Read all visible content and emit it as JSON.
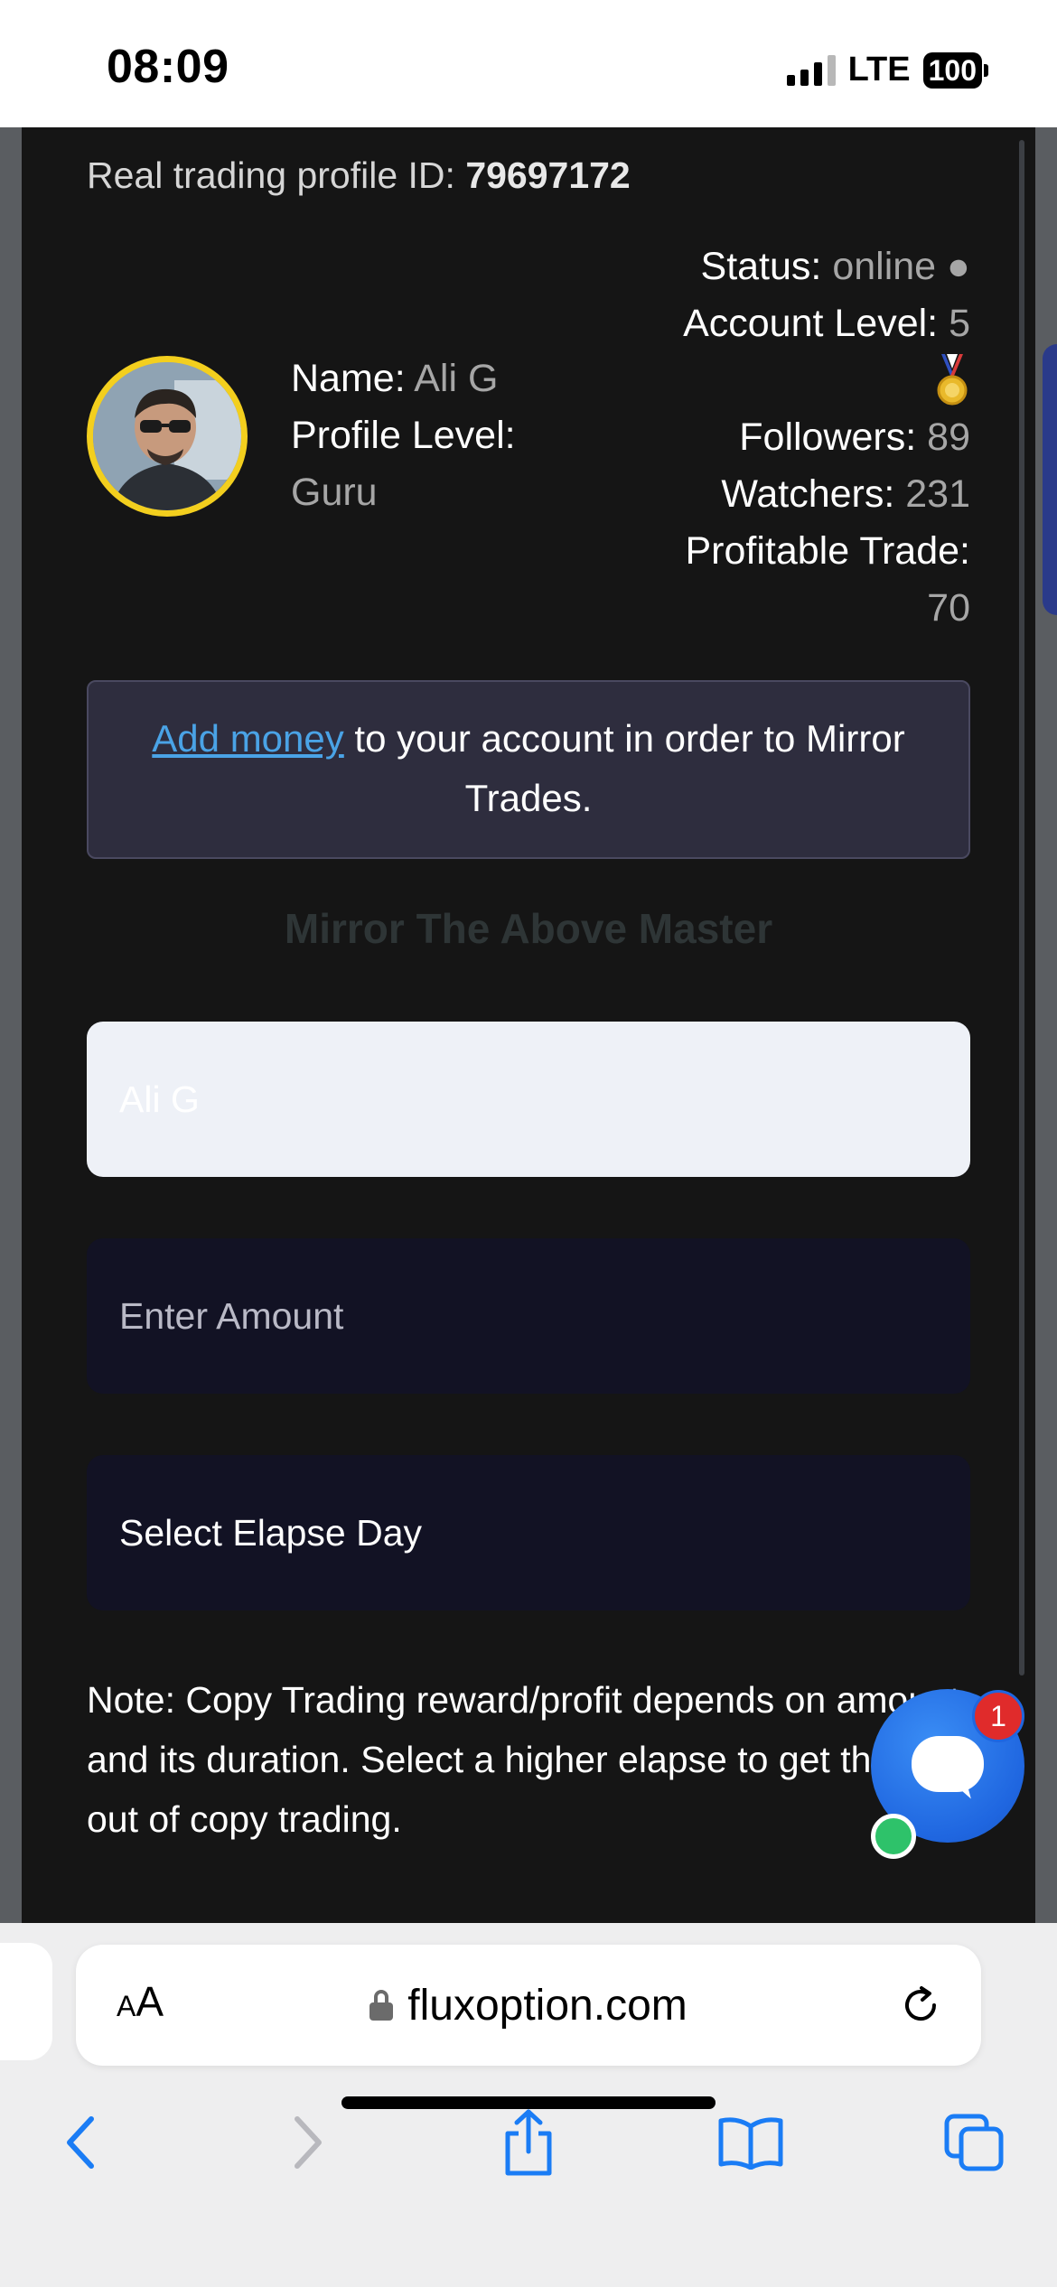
{
  "status_bar": {
    "time": "08:09",
    "network": "LTE",
    "battery": "100"
  },
  "profile": {
    "id_label": "Real trading profile ID: ",
    "id_value": "79697172",
    "name_label": "Name: ",
    "name_value": "Ali G",
    "level_label": "Profile Level:",
    "level_value": "Guru",
    "status_label": "Status: ",
    "status_value": "online ●",
    "account_level_label": "Account Level: ",
    "account_level_value": "5",
    "followers_label": "Followers: ",
    "followers_value": "89",
    "watchers_label": "Watchers: ",
    "watchers_value": "231",
    "profitable_label": "Profitable Trade:",
    "profitable_value": "70"
  },
  "notice": {
    "link_text": "Add money",
    "text": " to your account in order to Mirror Trades."
  },
  "mirror_form": {
    "title": "Mirror The Above Master",
    "name_value": "Ali G",
    "amount_placeholder": "Enter Amount",
    "elapse_select": "Select Elapse Day",
    "note": "Note: Copy Trading reward/profit depends on amount and its duration. Select a higher elapse to get the most out of copy trading."
  },
  "chat_widget": {
    "badge_count": "1"
  },
  "browser": {
    "url": "fluxoption.com",
    "text_size_label_small": "A",
    "text_size_label_large": "A"
  },
  "colors": {
    "page_bg": "#151515",
    "accent_link": "#4aa3e6",
    "avatar_ring": "#f3cf1e",
    "chat_blue": "#1f66e0",
    "badge_red": "#e02b2b",
    "online_green": "#2ec26a"
  },
  "icons": {
    "back": "chevron-left-icon",
    "forward": "chevron-right-icon",
    "share": "share-icon",
    "bookmarks": "book-icon",
    "tabs": "tabs-icon",
    "reload": "reload-icon",
    "lock": "lock-icon",
    "medal": "medal-icon",
    "chat": "chat-icon"
  }
}
